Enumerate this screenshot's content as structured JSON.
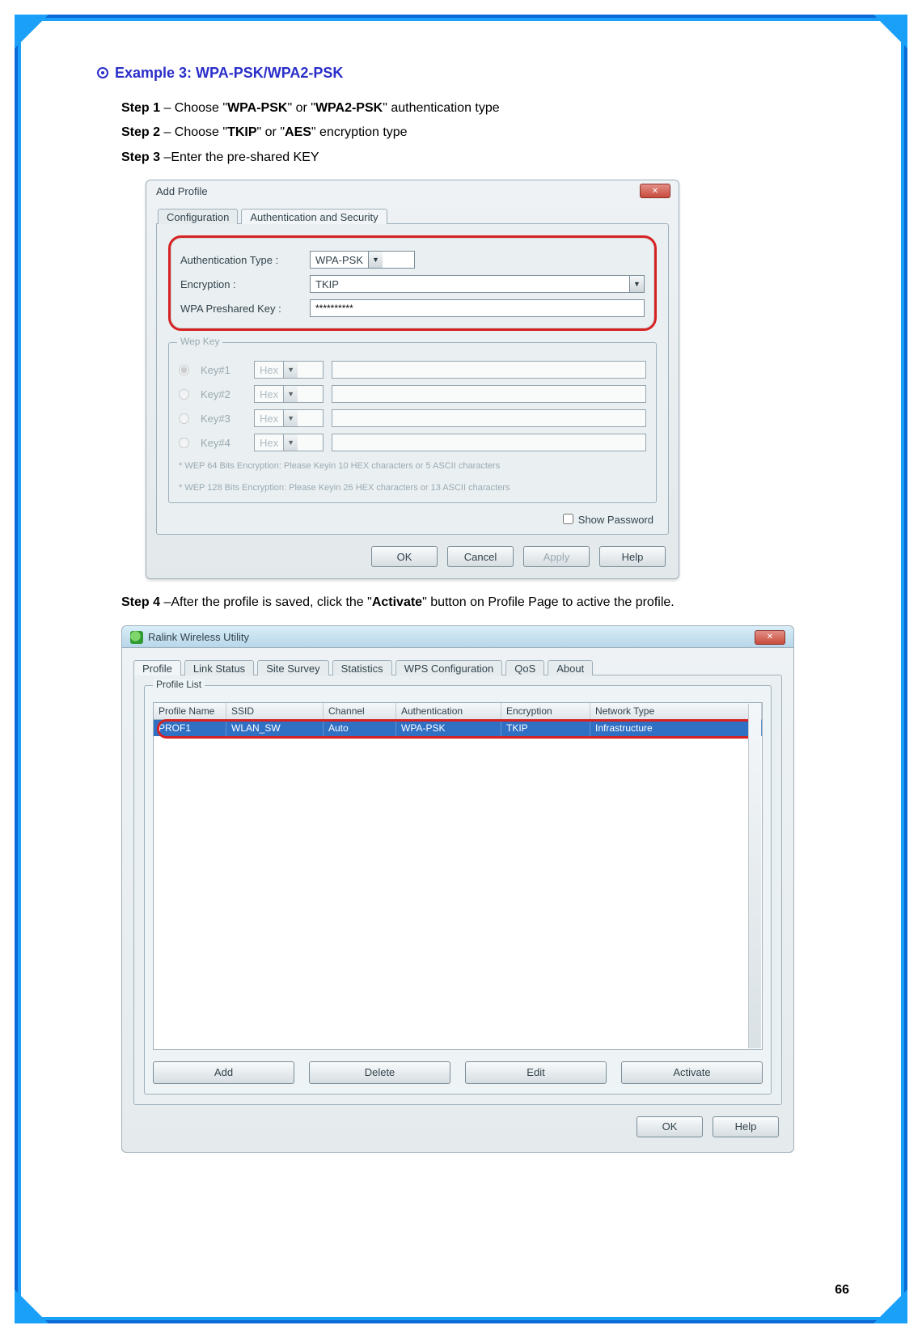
{
  "heading": "Example 3: WPA-PSK/WPA2-PSK",
  "steps": {
    "s1_a": "Step 1",
    "s1_b": " – Choose \"",
    "s1_c": "WPA-PSK",
    "s1_d": "\" or \"",
    "s1_e": "WPA2-PSK",
    "s1_f": "\" authentication type",
    "s2_a": "Step 2",
    "s2_b": " – Choose \"",
    "s2_c": "TKIP",
    "s2_d": "\" or \"",
    "s2_e": "AES",
    "s2_f": "\" encryption type",
    "s3_a": "Step 3",
    "s3_b": " –Enter the pre-shared KEY",
    "s4_a": "Step 4",
    "s4_b": " –After the profile is saved, click the \"",
    "s4_c": "Activate",
    "s4_d": "\" button on Profile Page to active the profile."
  },
  "addProfile": {
    "title": "Add Profile",
    "tabs": {
      "config": "Configuration",
      "auth": "Authentication and Security"
    },
    "fields": {
      "authTypeLabel": "Authentication Type :",
      "authTypeValue": "WPA-PSK",
      "encryptionLabel": "Encryption :",
      "encryptionValue": "TKIP",
      "pskLabel": "WPA Preshared Key :",
      "pskValue": "**********"
    },
    "wep": {
      "groupTitle": "Wep Key",
      "rows": [
        {
          "label": "Key#1",
          "type": "Hex",
          "checked": true
        },
        {
          "label": "Key#2",
          "type": "Hex",
          "checked": false
        },
        {
          "label": "Key#3",
          "type": "Hex",
          "checked": false
        },
        {
          "label": "Key#4",
          "type": "Hex",
          "checked": false
        }
      ],
      "note1": "* WEP 64 Bits Encryption:  Please Keyin 10 HEX characters or 5 ASCII characters",
      "note2": "* WEP 128 Bits Encryption:  Please Keyin 26 HEX characters or 13 ASCII characters"
    },
    "showPassword": "Show Password",
    "buttons": {
      "ok": "OK",
      "cancel": "Cancel",
      "apply": "Apply",
      "help": "Help"
    }
  },
  "utility": {
    "title": "Ralink Wireless Utility",
    "tabs": [
      "Profile",
      "Link Status",
      "Site Survey",
      "Statistics",
      "WPS Configuration",
      "QoS",
      "About"
    ],
    "profileListTitle": "Profile List",
    "columns": [
      "Profile Name",
      "SSID",
      "Channel",
      "Authentication",
      "Encryption",
      "Network Type"
    ],
    "row": {
      "name": "PROF1",
      "ssid": "WLAN_SW",
      "channel": "Auto",
      "auth": "WPA-PSK",
      "enc": "TKIP",
      "net": "Infrastructure"
    },
    "buttons": {
      "add": "Add",
      "del": "Delete",
      "edit": "Edit",
      "activate": "Activate"
    },
    "footer": {
      "ok": "OK",
      "help": "Help"
    }
  },
  "pageNumber": "66"
}
